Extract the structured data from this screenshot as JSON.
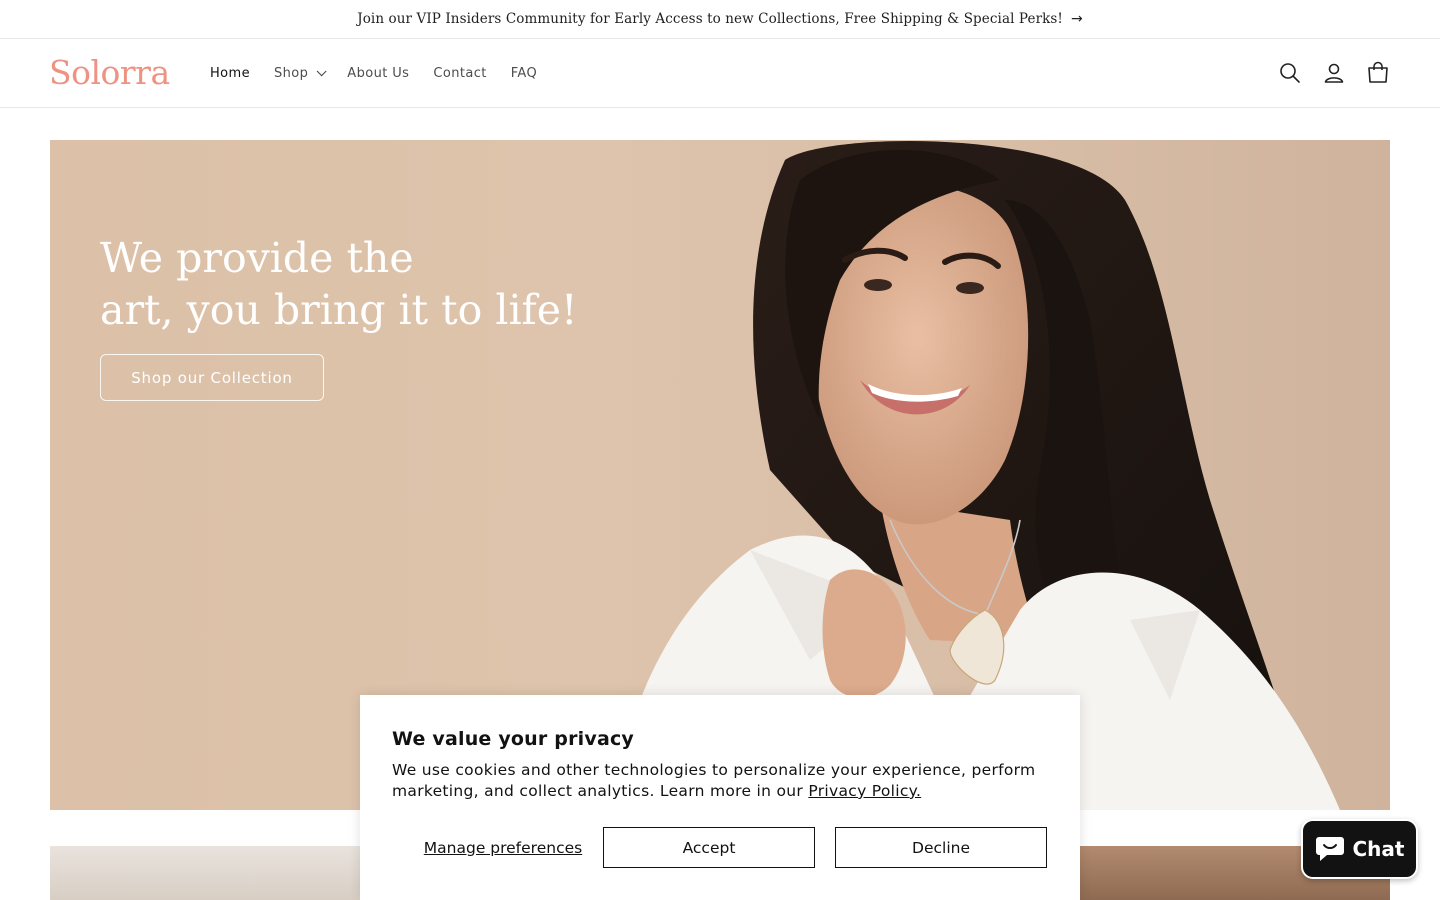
{
  "announcement": {
    "text": "Join our VIP Insiders Community for Early Access to new Collections, Free Shipping & Special Perks!",
    "arrow": "→"
  },
  "header": {
    "logo": "Solorra",
    "nav": [
      {
        "label": "Home",
        "active": true
      },
      {
        "label": "Shop",
        "has_dropdown": true
      },
      {
        "label": "About Us"
      },
      {
        "label": "Contact"
      },
      {
        "label": "FAQ"
      }
    ],
    "icons": [
      "search-icon",
      "account-icon",
      "cart-icon"
    ]
  },
  "hero": {
    "title_line1": "We provide the",
    "title_line2": "art, you bring it to life!",
    "button": "Shop our Collection"
  },
  "cookie_banner": {
    "title": "We value your privacy",
    "body": "We use cookies and other technologies to personalize your experience, perform marketing, and collect analytics. Learn more in our ",
    "link": "Privacy Policy.",
    "manage": "Manage preferences",
    "accept": "Accept",
    "decline": "Decline"
  },
  "chat": {
    "label": "Chat"
  },
  "colors": {
    "brand": "#ee9383",
    "hero_bg": "#dcc0a8",
    "chat_bg": "#121212"
  }
}
